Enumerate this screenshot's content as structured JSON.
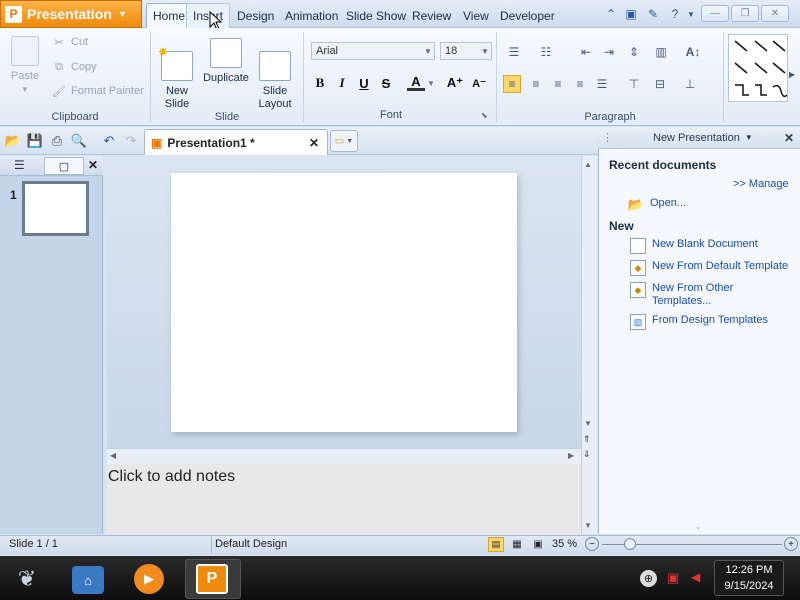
{
  "app": {
    "name": "Presentation"
  },
  "tabs": [
    {
      "label": "Home"
    },
    {
      "label": "Insert"
    },
    {
      "label": "Design"
    },
    {
      "label": "Animation"
    },
    {
      "label": "Slide Show"
    },
    {
      "label": "Review"
    },
    {
      "label": "View"
    },
    {
      "label": "Developer"
    }
  ],
  "ribbon": {
    "clipboard": {
      "paste": "Paste",
      "cut": "Cut",
      "copy": "Copy",
      "format_painter": "Format Painter",
      "label": "Clipboard"
    },
    "slide": {
      "new_slide": "New\nSlide",
      "duplicate": "Duplicate",
      "slide_layout": "Slide\nLayout",
      "label": "Slide"
    },
    "font": {
      "name": "Arial",
      "size": "18",
      "bold": "B",
      "italic": "I",
      "underline": "U",
      "strike": "S",
      "label": "Font"
    },
    "paragraph": {
      "label": "Paragraph"
    }
  },
  "document": {
    "tab_title": "Presentation1 *"
  },
  "slides": [
    {
      "number": "1"
    }
  ],
  "notes": {
    "placeholder": "Click to add notes"
  },
  "taskpane": {
    "title": "New Presentation",
    "recent_heading": "Recent documents",
    "manage": ">> Manage",
    "open": "Open...",
    "new_heading": "New",
    "items": [
      {
        "label": "New Blank Document"
      },
      {
        "label": "New From Default Template"
      },
      {
        "label": "New From Other Templates..."
      },
      {
        "label": "From Design Templates"
      }
    ]
  },
  "status": {
    "slide": "Slide 1 / 1",
    "design": "Default Design",
    "zoom": "35 %"
  },
  "clock": {
    "time": "12:26 PM",
    "date": "9/15/2024"
  },
  "colors": {
    "accent": "#f08a0c",
    "link": "#1a4fb0"
  }
}
